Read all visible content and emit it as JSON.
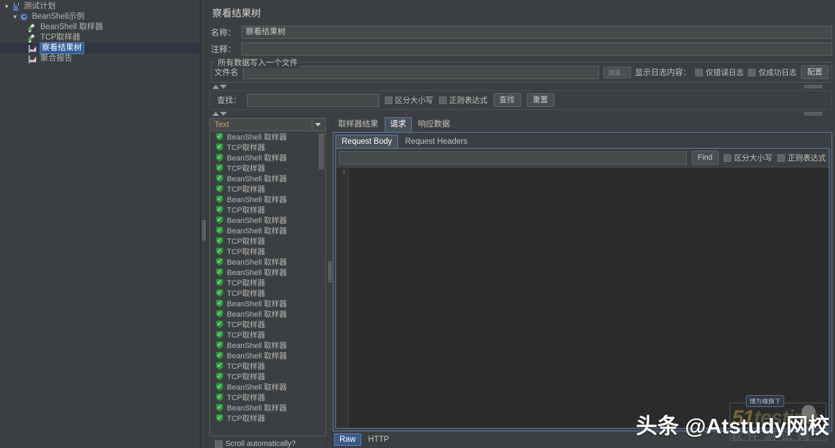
{
  "tree": {
    "nodes": [
      {
        "label": "测试计划",
        "level": 0,
        "icon": "flask-icon",
        "twisty": "▼",
        "selected": false
      },
      {
        "label": "BeanShell示例",
        "level": 1,
        "icon": "gear-icon",
        "twisty": "▼",
        "selected": false
      },
      {
        "label": "BeanShell 取样器",
        "level": 2,
        "icon": "pen-icon",
        "twisty": "",
        "selected": false
      },
      {
        "label": "TCP取样器",
        "level": 2,
        "icon": "pen-icon",
        "twisty": "",
        "selected": false
      },
      {
        "label": "察看结果树",
        "level": 2,
        "icon": "chart-icon",
        "twisty": "",
        "selected": true
      },
      {
        "label": "聚合报告",
        "level": 2,
        "icon": "chart-icon",
        "twisty": "",
        "selected": false
      }
    ]
  },
  "panel": {
    "title": "察看结果树",
    "name_label": "名称：",
    "name_value": "察看结果树",
    "comment_label": "注释：",
    "comment_value": "",
    "filegroup": {
      "legend": "所有数据写入一个文件",
      "filename_label": "文件名",
      "filename_value": "",
      "browse_button": "浏览...",
      "log_content_label": "显示日志内容：",
      "errors_only": "仅错误日志",
      "success_only": "仅成功日志",
      "config_button": "配置"
    },
    "search": {
      "label": "查找：",
      "value": "",
      "case_sensitive": "区分大小写",
      "regex": "正则表达式",
      "find_button": "查找",
      "reset_button": "重置"
    }
  },
  "results": {
    "renderer_selected": "Text",
    "scroll_auto_label": "Scroll automatically?",
    "items": [
      "BeanShell 取样器",
      "TCP取样器",
      "BeanShell 取样器",
      "TCP取样器",
      "BeanShell 取样器",
      "TCP取样器",
      "BeanShell 取样器",
      "TCP取样器",
      "BeanShell 取样器",
      "BeanShell 取样器",
      "TCP取样器",
      "TCP取样器",
      "BeanShell 取样器",
      "BeanShell 取样器",
      "TCP取样器",
      "TCP取样器",
      "BeanShell 取样器",
      "BeanShell 取样器",
      "TCP取样器",
      "TCP取样器",
      "BeanShell 取样器",
      "BeanShell 取样器",
      "TCP取样器",
      "TCP取样器",
      "BeanShell 取样器",
      "TCP取样器",
      "BeanShell 取样器",
      "TCP取样器"
    ]
  },
  "detail": {
    "tabs": [
      {
        "label": "取样器结果",
        "active": false
      },
      {
        "label": "请求",
        "active": true
      },
      {
        "label": "响应数据",
        "active": false
      }
    ],
    "subtabs": [
      {
        "label": "Request Body",
        "active": true
      },
      {
        "label": "Request Headers",
        "active": false
      }
    ],
    "find": {
      "value": "",
      "button": "Find",
      "case_sensitive": "区分大小写",
      "regex": "正则表达式"
    },
    "editor": {
      "line_number": "1",
      "content": ""
    },
    "rawtabs": [
      {
        "label": "Raw",
        "active": true
      },
      {
        "label": "HTTP",
        "active": false
      }
    ]
  },
  "watermark": {
    "badge": "博为峰旗下",
    "brand_51": "51",
    "brand_testing": "testing",
    "brand_cn": "软件测试网",
    "overlay": "头条 @Atstudy网校"
  },
  "colors": {
    "background": "#3c3f41",
    "selection_blue": "#2e5a96",
    "tab_border": "#5c7fb0",
    "editor_bg": "#2b2b2b",
    "success_green": "#2f9e3f",
    "combo_text": "#cc9b5f"
  }
}
